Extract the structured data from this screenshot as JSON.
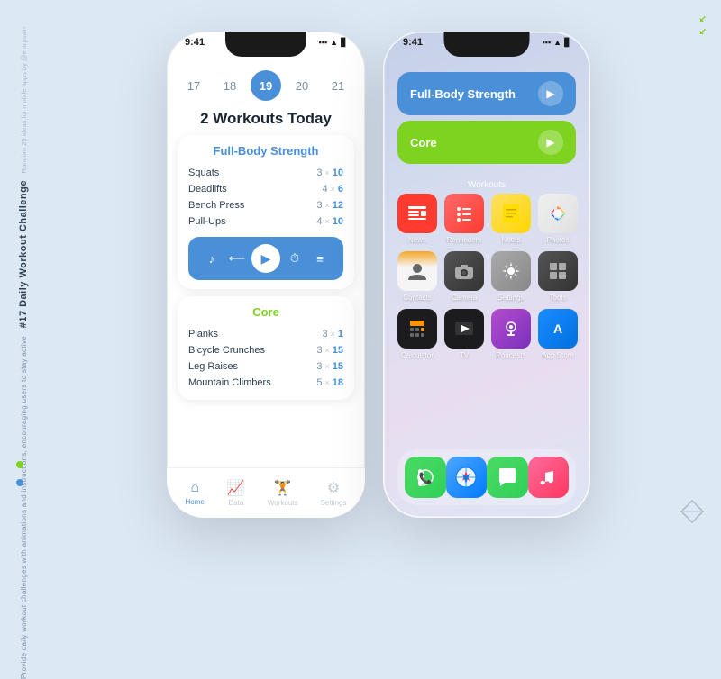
{
  "sidebar": {
    "meta": "Random 25 ideas for mobile apps by @entrpswn",
    "title": "#17 Daily Workout Challenge",
    "subtitle": "Provide daily workout challenges with animations and instructions, encouraging users to stay active"
  },
  "arrows": [
    "↙",
    "↙"
  ],
  "left_phone": {
    "status": {
      "time": "9:41",
      "signal": "●●●",
      "wifi": "▲",
      "battery": "▐"
    },
    "dates": [
      {
        "num": "17",
        "active": false
      },
      {
        "num": "18",
        "active": false
      },
      {
        "num": "19",
        "active": true
      },
      {
        "num": "20",
        "active": false
      },
      {
        "num": "21",
        "active": false
      }
    ],
    "workout_count": "2 Workouts Today",
    "workout1": {
      "title": "Full-Body Strength",
      "exercises": [
        {
          "name": "Squats",
          "sets": "3",
          "reps": "10"
        },
        {
          "name": "Deadlifts",
          "sets": "4",
          "reps": "6"
        },
        {
          "name": "Bench Press",
          "sets": "3",
          "reps": "12"
        },
        {
          "name": "Pull-Ups",
          "sets": "4",
          "reps": "10"
        }
      ]
    },
    "workout2": {
      "title": "Core",
      "exercises": [
        {
          "name": "Planks",
          "sets": "3",
          "reps": "1"
        },
        {
          "name": "Bicycle Crunches",
          "sets": "3",
          "reps": "15"
        },
        {
          "name": "Leg Raises",
          "sets": "3",
          "reps": "15"
        },
        {
          "name": "Mountain Climbers",
          "sets": "5",
          "reps": "18"
        }
      ]
    },
    "nav": [
      {
        "label": "Home",
        "icon": "⌂",
        "active": true
      },
      {
        "label": "Data",
        "icon": "📈",
        "active": false
      },
      {
        "label": "Workouts",
        "icon": "🏋",
        "active": false
      },
      {
        "label": "Settings",
        "icon": "⚙",
        "active": false
      }
    ]
  },
  "right_phone": {
    "status": {
      "time": "9:41",
      "signal": "●●●",
      "wifi": "▲",
      "battery": "▐"
    },
    "widgets": [
      {
        "label": "Full-Body Strength",
        "color": "blue"
      },
      {
        "label": "Core",
        "color": "green"
      }
    ],
    "folder_label": "Workouts",
    "apps_row1": [
      {
        "name": "News",
        "icon": "📰",
        "class": "app-news"
      },
      {
        "name": "Reminders",
        "icon": "📋",
        "class": "app-reminders"
      },
      {
        "name": "Notes",
        "icon": "📝",
        "class": "app-notes"
      },
      {
        "name": "Photos",
        "icon": "🌸",
        "class": "app-photos"
      }
    ],
    "apps_row2": [
      {
        "name": "Contacts",
        "icon": "👤",
        "class": "app-contacts"
      },
      {
        "name": "Camera",
        "icon": "📷",
        "class": "app-camera"
      },
      {
        "name": "Settings",
        "icon": "⚙️",
        "class": "app-settings"
      },
      {
        "name": "Tools",
        "icon": "▦",
        "class": "app-tools"
      }
    ],
    "apps_row3": [
      {
        "name": "Calculator",
        "icon": "🔢",
        "class": "app-calculator"
      },
      {
        "name": "TV",
        "icon": "▶",
        "class": "app-tv"
      },
      {
        "name": "Podcasts",
        "icon": "🎙",
        "class": "app-podcasts"
      },
      {
        "name": "App Store",
        "icon": "A",
        "class": "app-appstore"
      }
    ],
    "dock": [
      {
        "name": "Phone",
        "icon": "📞",
        "class": "dock-phone"
      },
      {
        "name": "Safari",
        "icon": "🧭",
        "class": "dock-safari"
      },
      {
        "name": "Messages",
        "icon": "💬",
        "class": "dock-messages"
      },
      {
        "name": "Music",
        "icon": "♪",
        "class": "dock-music"
      }
    ]
  }
}
